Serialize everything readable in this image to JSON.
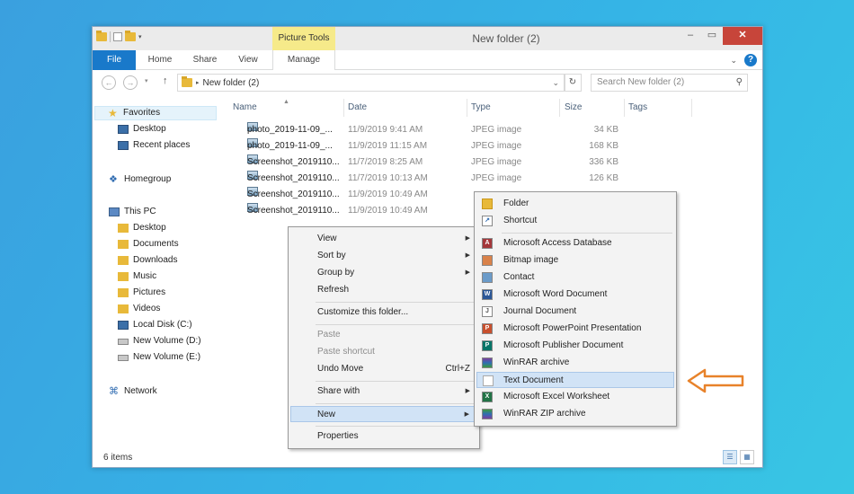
{
  "window": {
    "title": "New folder (2)",
    "context_tab": "Picture Tools",
    "tabs": [
      "File",
      "Home",
      "Share",
      "View",
      "Manage"
    ]
  },
  "address": {
    "path": "New folder (2)",
    "search_placeholder": "Search New folder (2)"
  },
  "nav": {
    "favorites": "Favorites",
    "favorite_items": [
      "Desktop",
      "Recent places"
    ],
    "homegroup": "Homegroup",
    "this_pc": "This PC",
    "pc_items": [
      "Desktop",
      "Documents",
      "Downloads",
      "Music",
      "Pictures",
      "Videos",
      "Local Disk (C:)",
      "New Volume (D:)",
      "New Volume (E:)"
    ],
    "network": "Network"
  },
  "columns": [
    "Name",
    "Date",
    "Type",
    "Size",
    "Tags"
  ],
  "files": [
    {
      "name": "photo_2019-11-09_...",
      "date": "11/9/2019 9:41 AM",
      "type": "JPEG image",
      "size": "34 KB"
    },
    {
      "name": "photo_2019-11-09_...",
      "date": "11/9/2019 11:15 AM",
      "type": "JPEG image",
      "size": "168 KB"
    },
    {
      "name": "Screenshot_2019110...",
      "date": "11/7/2019 8:25 AM",
      "type": "JPEG image",
      "size": "336 KB"
    },
    {
      "name": "Screenshot_2019110...",
      "date": "11/7/2019 10:13 AM",
      "type": "JPEG image",
      "size": "126 KB"
    },
    {
      "name": "Screenshot_2019110...",
      "date": "11/9/2019 10:49 AM",
      "type": "",
      "size": ""
    },
    {
      "name": "Screenshot_2019110...",
      "date": "11/9/2019 10:49 AM",
      "type": "",
      "size": ""
    }
  ],
  "status": {
    "count": "6 items"
  },
  "context_menu": {
    "view": "View",
    "sort_by": "Sort by",
    "group_by": "Group by",
    "refresh": "Refresh",
    "customize": "Customize this folder...",
    "paste": "Paste",
    "paste_shortcut": "Paste shortcut",
    "undo_move": "Undo Move",
    "undo_shortcut": "Ctrl+Z",
    "share_with": "Share with",
    "new": "New",
    "properties": "Properties"
  },
  "new_submenu": {
    "folder": "Folder",
    "shortcut": "Shortcut",
    "items": [
      "Microsoft Access Database",
      "Bitmap image",
      "Contact",
      "Microsoft Word Document",
      "Journal Document",
      "Microsoft PowerPoint Presentation",
      "Microsoft Publisher Document",
      "WinRAR archive",
      "Text Document",
      "Microsoft Excel Worksheet",
      "WinRAR ZIP archive"
    ],
    "highlighted": "Text Document"
  },
  "colors": {
    "accent": "#1979ca",
    "callout_arrow": "#e8822a",
    "menu_highlight": "#d1e3f6"
  }
}
